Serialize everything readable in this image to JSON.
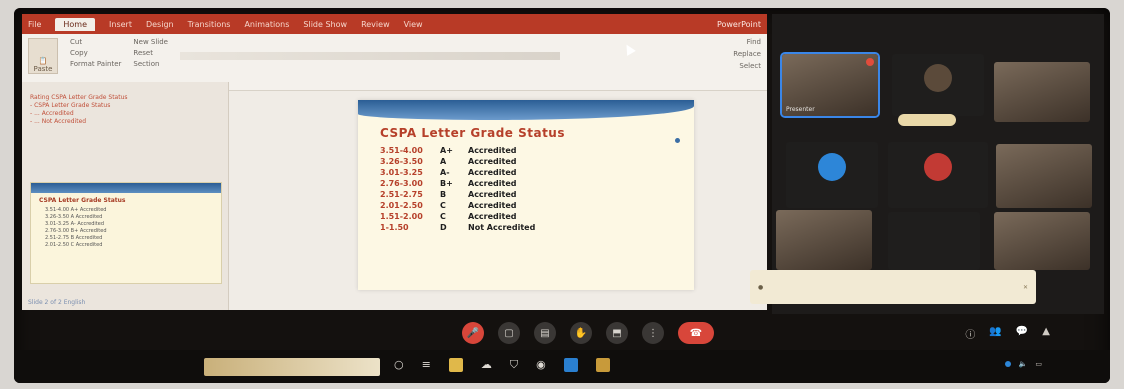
{
  "ppt": {
    "tabs": [
      "File",
      "Home",
      "Insert",
      "Design",
      "Transitions",
      "Animations",
      "Slide Show",
      "Review",
      "View"
    ],
    "active_tab": "Home",
    "doc_title": "PowerPoint",
    "paste_label": "Paste",
    "ribbon_group_1": [
      "Cut",
      "Copy",
      "Format Painter"
    ],
    "ribbon_group_2": [
      "New Slide",
      "Reset",
      "Section"
    ],
    "ribbon_right": [
      "Find",
      "Replace",
      "Select"
    ],
    "notes_lines": [
      "Rating CSPA Letter Grade Status",
      "- CSPA Letter Grade Status",
      "- ... Accredited",
      "- ... Not Accredited"
    ],
    "thumb_title": "CSPA Letter Grade Status",
    "thumb_rows": [
      "3.51-4.00 A+ Accredited",
      "3.26-3.50 A Accredited",
      "3.01-3.25 A- Accredited",
      "2.76-3.00 B+ Accredited",
      "2.51-2.75 B Accredited",
      "2.01-2.50 C Accredited"
    ],
    "status_text": "Slide 2 of 2  English",
    "slide": {
      "title": "CSPA Letter Grade Status",
      "rows": [
        {
          "range": "3.51-4.00",
          "grade": "A+",
          "status": "Accredited"
        },
        {
          "range": "3.26-3.50",
          "grade": "A",
          "status": "Accredited"
        },
        {
          "range": "3.01-3.25",
          "grade": "A-",
          "status": "Accredited"
        },
        {
          "range": "2.76-3.00",
          "grade": "B+",
          "status": "Accredited"
        },
        {
          "range": "2.51-2.75",
          "grade": "B",
          "status": "Accredited"
        },
        {
          "range": "2.01-2.50",
          "grade": "C",
          "status": "Accredited"
        },
        {
          "range": "1.51-2.00",
          "grade": "C",
          "status": "Accredited"
        },
        {
          "range": "1-1.50",
          "grade": "D",
          "status": "Not Accredited"
        }
      ]
    }
  },
  "participants": {
    "tiles": [
      {
        "name": "Presenter",
        "type": "video",
        "active": true
      },
      {
        "name": "",
        "type": "dark",
        "initial": ""
      },
      {
        "name": "",
        "type": "video"
      },
      {
        "name": "",
        "type": "dark",
        "initial": ""
      },
      {
        "name": "",
        "type": "dark",
        "initial": ""
      },
      {
        "name": "",
        "type": "video"
      },
      {
        "name": "",
        "type": "video"
      },
      {
        "name": "",
        "type": "dark"
      },
      {
        "name": "",
        "type": "video"
      }
    ],
    "name_chip": "",
    "notification": {
      "text": "",
      "button": "",
      "close": "✕"
    }
  },
  "controls": {
    "meeting_code": "",
    "buttons": [
      "mic-off",
      "camera",
      "captions",
      "raise-hand",
      "present",
      "more",
      "hang-up"
    ],
    "side": [
      "info",
      "people",
      "chat",
      "activities"
    ]
  },
  "taskbar": {
    "search_placeholder": "",
    "apps": [
      "search",
      "task-view",
      "file-explorer",
      "edge",
      "store",
      "chrome",
      "mail",
      "files"
    ],
    "tray_time": ""
  }
}
